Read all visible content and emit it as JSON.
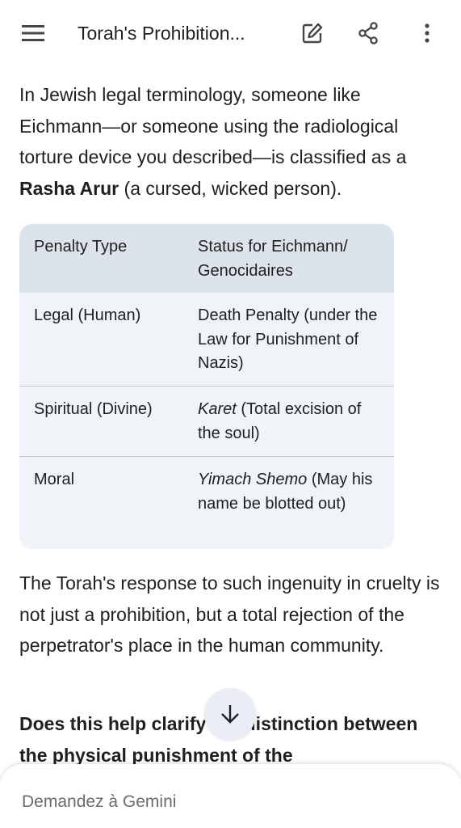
{
  "header": {
    "title": "Torah's Prohibition...",
    "icons": [
      "menu-icon",
      "edit-icon",
      "share-icon",
      "more-vert-icon"
    ]
  },
  "content": {
    "para1_a": "In Jewish legal terminology, someone like Eichmann—or someone using the radiological torture device you described—is classified as a ",
    "para1_bold": "Rasha Arur",
    "para1_b": " (a cursed, wicked person).",
    "table": {
      "headers": [
        "Penalty Type",
        "Status for Eichmann/ Genocidaires"
      ],
      "rows": [
        {
          "type": "Legal (Human)",
          "status_em": "",
          "status": "Death Penalty (under the Law for Punishment of Nazis)"
        },
        {
          "type": "Spiritual (Divine)",
          "status_em": "Karet",
          "status": " (Total excision of the soul)"
        },
        {
          "type": "Moral",
          "status_em": "Yimach Shemo",
          "status": " (May his name be blotted out)"
        }
      ]
    },
    "para2": "The Torah's response to such ingenuity in cruelty is not just a prohibition, but a total rejection of the perpetrator's place in the human community.",
    "question": "Does this help clarify the distinction between the physical punishment of the"
  },
  "input": {
    "placeholder": "Demandez à Gemini"
  }
}
